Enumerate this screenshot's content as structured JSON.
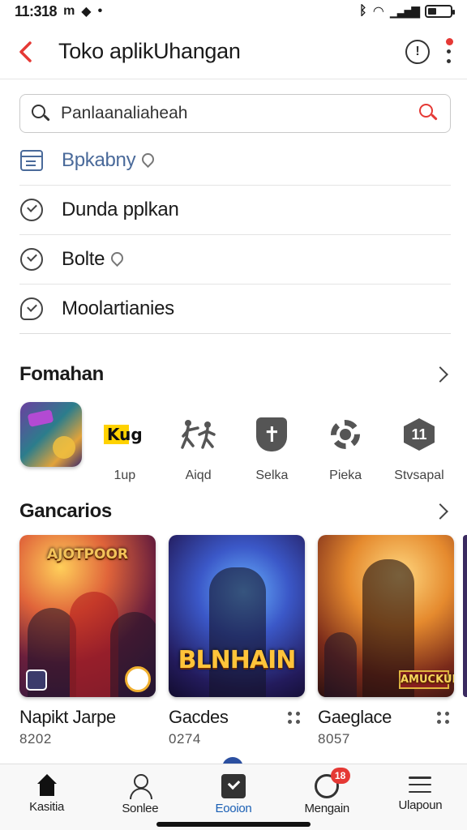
{
  "status_bar": {
    "time": "11:318",
    "left_icons": [
      "m",
      "wifi-signal",
      "dot"
    ],
    "battery_icon": "battery-icon"
  },
  "header": {
    "title": "Toko aplikUhangan",
    "back_icon": "back-icon",
    "info_glyph": "!"
  },
  "search": {
    "placeholder": "Panlaanaliaheah"
  },
  "menu": [
    {
      "label": "Bpkabny",
      "icon": "window-icon",
      "pinned": true
    },
    {
      "label": "Dunda pplkan",
      "icon": "check-circle-icon",
      "pinned": false
    },
    {
      "label": "Bolte",
      "icon": "check-circle-icon",
      "pinned": true
    },
    {
      "label": "Moolartianies",
      "icon": "chat-check-icon",
      "pinned": false
    }
  ],
  "sections": {
    "apps_title": "Fomahan",
    "games_title": "Gancarios"
  },
  "apps": [
    {
      "label": "",
      "icon": "game-app-icon"
    },
    {
      "label": "1up",
      "icon": "kug-logo",
      "logo_text": "Kug"
    },
    {
      "label": "Aiqd",
      "icon": "fighter-icon",
      "glyph": "🤺"
    },
    {
      "label": "Selka",
      "icon": "shield-icon",
      "glyph": "✝"
    },
    {
      "label": "Pieka",
      "icon": "gear-icon"
    },
    {
      "label": "Stvsapal",
      "icon": "hex-icon",
      "glyph": "11"
    }
  ],
  "games": [
    {
      "title": "Napikt Jarpe",
      "size": "8202",
      "cover_text": "AJOTPOOR"
    },
    {
      "title": "Gacdes",
      "size": "0274",
      "cover_text": "BLNHAIN"
    },
    {
      "title": "Gaeglace",
      "size": "8057",
      "cover_text": "AMUCKULA"
    }
  ],
  "bottom_nav": [
    {
      "label": "Kasitia",
      "icon": "home-icon",
      "active": false
    },
    {
      "label": "Sonlee",
      "icon": "person-icon",
      "active": false
    },
    {
      "label": "Eooion",
      "icon": "check-box-icon",
      "active": true
    },
    {
      "label": "Mengain",
      "icon": "moon-icon",
      "active": false,
      "badge": "18"
    },
    {
      "label": "Ulapoun",
      "icon": "menu-icon",
      "active": false
    }
  ],
  "colors": {
    "accent": "#e53935",
    "active_nav": "#1a5fb4",
    "link_blue": "#4a6a9a"
  }
}
